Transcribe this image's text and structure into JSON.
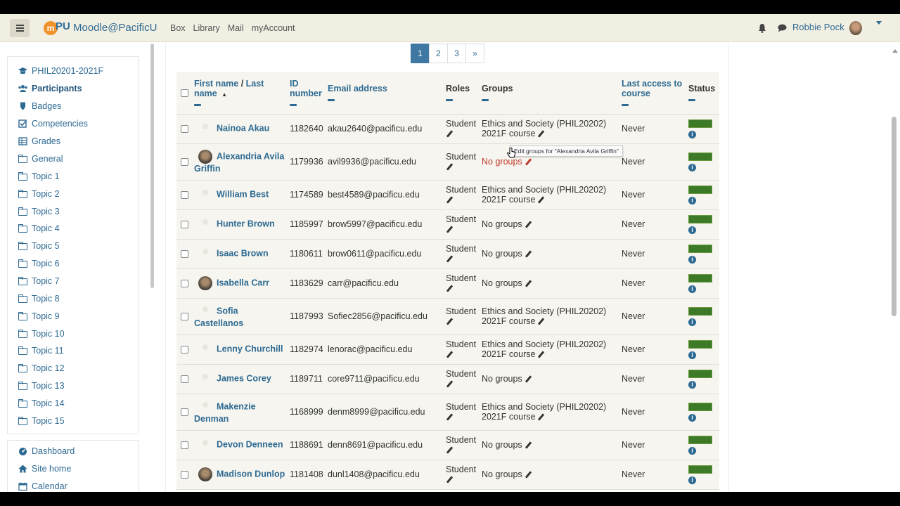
{
  "navbar": {
    "logo_mark": "m",
    "logo_pu": "PU",
    "site_name": "Moodle@PacificU",
    "links": [
      "Box",
      "Library",
      "Mail",
      "myAccount"
    ],
    "user_name": "Robbie Pock"
  },
  "drawer": {
    "items": [
      {
        "label": "PHIL20201-2021F",
        "icon": "graduation-cap-icon",
        "bold": false
      },
      {
        "label": "Participants",
        "icon": "users-icon",
        "bold": true
      },
      {
        "label": "Badges",
        "icon": "shield-icon",
        "bold": false
      },
      {
        "label": "Competencies",
        "icon": "check-square-icon",
        "bold": false
      },
      {
        "label": "Grades",
        "icon": "table-icon",
        "bold": false
      },
      {
        "label": "General",
        "icon": "folder-icon",
        "bold": false
      },
      {
        "label": "Topic 1",
        "icon": "folder-icon",
        "bold": false
      },
      {
        "label": "Topic 2",
        "icon": "folder-icon",
        "bold": false
      },
      {
        "label": "Topic 3",
        "icon": "folder-icon",
        "bold": false
      },
      {
        "label": "Topic 4",
        "icon": "folder-icon",
        "bold": false
      },
      {
        "label": "Topic 5",
        "icon": "folder-icon",
        "bold": false
      },
      {
        "label": "Topic 6",
        "icon": "folder-icon",
        "bold": false
      },
      {
        "label": "Topic 7",
        "icon": "folder-icon",
        "bold": false
      },
      {
        "label": "Topic 8",
        "icon": "folder-icon",
        "bold": false
      },
      {
        "label": "Topic 9",
        "icon": "folder-icon",
        "bold": false
      },
      {
        "label": "Topic 10",
        "icon": "folder-icon",
        "bold": false
      },
      {
        "label": "Topic 11",
        "icon": "folder-icon",
        "bold": false
      },
      {
        "label": "Topic 12",
        "icon": "folder-icon",
        "bold": false
      },
      {
        "label": "Topic 13",
        "icon": "folder-icon",
        "bold": false
      },
      {
        "label": "Topic 14",
        "icon": "folder-icon",
        "bold": false
      },
      {
        "label": "Topic 15",
        "icon": "folder-icon",
        "bold": false
      }
    ],
    "bottom_items": [
      {
        "label": "Dashboard",
        "icon": "dashboard-icon"
      },
      {
        "label": "Site home",
        "icon": "home-icon"
      },
      {
        "label": "Calendar",
        "icon": "calendar-icon"
      }
    ]
  },
  "pagination": {
    "pages": [
      "1",
      "2",
      "3",
      "»"
    ],
    "current": "1"
  },
  "table": {
    "headers": {
      "first_name": "First name",
      "slash": " / ",
      "last_name": "Last name",
      "sort_arrow": "▲",
      "id_number": "ID number",
      "email": "Email address",
      "roles": "Roles",
      "groups": "Groups",
      "last_access": "Last access to course",
      "status": "Status"
    },
    "rows": [
      {
        "name": "Nainoa Akau",
        "id": "1182640",
        "email": "akau2640@pacificu.edu",
        "role": "Student",
        "groups": "Ethics and Society (PHIL20202) 2021F course",
        "access": "Never",
        "photo": false
      },
      {
        "name": "Alexandria Avila Griffin",
        "id": "1179936",
        "email": "avil9936@pacificu.edu",
        "role": "Student",
        "groups": "No groups",
        "access": "Never",
        "photo": true
      },
      {
        "name": "William Best",
        "id": "1174589",
        "email": "best4589@pacificu.edu",
        "role": "Student",
        "groups": "Ethics and Society (PHIL20202) 2021F course",
        "access": "Never",
        "photo": false
      },
      {
        "name": "Hunter Brown",
        "id": "1185997",
        "email": "brow5997@pacificu.edu",
        "role": "Student",
        "groups": "No groups",
        "access": "Never",
        "photo": false
      },
      {
        "name": "Isaac Brown",
        "id": "1180611",
        "email": "brow0611@pacificu.edu",
        "role": "Student",
        "groups": "No groups",
        "access": "Never",
        "photo": false
      },
      {
        "name": "Isabella Carr",
        "id": "1183629",
        "email": "carr@pacificu.edu",
        "role": "Student",
        "groups": "No groups",
        "access": "Never",
        "photo": true
      },
      {
        "name": "Sofia Castellanos",
        "id": "1187993",
        "email": "Sofiec2856@pacificu.edu",
        "role": "Student",
        "groups": "Ethics and Society (PHIL20202) 2021F course",
        "access": "Never",
        "photo": false
      },
      {
        "name": "Lenny Churchill",
        "id": "1182974",
        "email": "lenorac@pacificu.edu",
        "role": "Student",
        "groups": "Ethics and Society (PHIL20202) 2021F course",
        "access": "Never",
        "photo": false
      },
      {
        "name": "James Corey",
        "id": "1189711",
        "email": "core9711@pacificu.edu",
        "role": "Student",
        "groups": "No groups",
        "access": "Never",
        "photo": false
      },
      {
        "name": "Makenzie Denman",
        "id": "1168999",
        "email": "denm8999@pacificu.edu",
        "role": "Student",
        "groups": "Ethics and Society (PHIL20202) 2021F course",
        "access": "Never",
        "photo": false
      },
      {
        "name": "Devon Denneen",
        "id": "1188691",
        "email": "denn8691@pacificu.edu",
        "role": "Student",
        "groups": "No groups",
        "access": "Never",
        "photo": false
      },
      {
        "name": "Madison Dunlop",
        "id": "1181408",
        "email": "dunl1408@pacificu.edu",
        "role": "Student",
        "groups": "No groups",
        "access": "Never",
        "photo": true
      }
    ]
  },
  "tooltip": "Edit groups for \"Alexandria Avila Griffin\"",
  "colors": {
    "accent": "#2d6a93",
    "navbar_bg": "#f1efe2",
    "status_active": "#3d7a28",
    "pager_active": "#3e78a3",
    "warning_red": "#c0392b"
  }
}
